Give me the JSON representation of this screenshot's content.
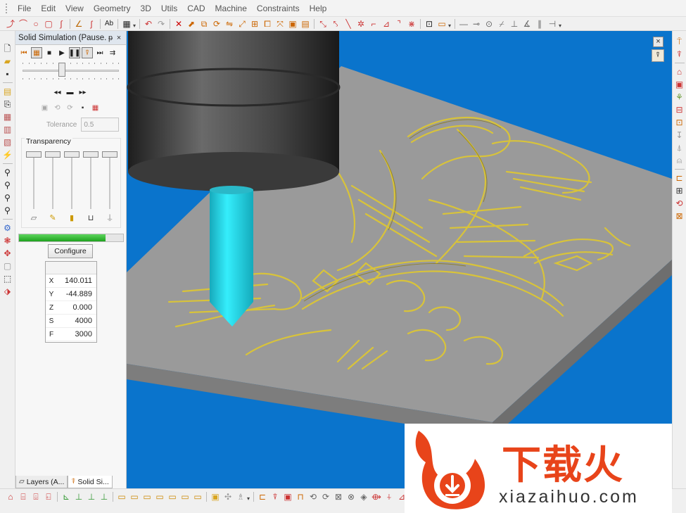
{
  "menu": [
    "File",
    "Edit",
    "View",
    "Geometry",
    "3D",
    "Utils",
    "CAD",
    "Machine",
    "Constraints",
    "Help"
  ],
  "panel": {
    "title": "Solid Simulation (Pause...",
    "pin": "ᵽ",
    "close": "×",
    "tolerance_label": "Tolerance",
    "tolerance_value": "0.5",
    "transparency_label": "Transparency",
    "progress_fraction": 0.83,
    "speed_fraction": 0.4,
    "configure_label": "Configure",
    "coords": [
      {
        "axis": "X",
        "value": "140.011"
      },
      {
        "axis": "Y",
        "value": "-44.889"
      },
      {
        "axis": "Z",
        "value": "0.000"
      },
      {
        "axis": "S",
        "value": "4000"
      },
      {
        "axis": "F",
        "value": "3000"
      }
    ],
    "tabs": [
      {
        "label": "Layers (A...",
        "active": false
      },
      {
        "label": "Solid Si...",
        "active": true
      }
    ]
  },
  "viewport": {
    "close_glyph": "×",
    "colors": {
      "background": "#0a74cc",
      "stock": "#9a9a9a",
      "engraving": "#d8c33a",
      "tool": "#22d8e8",
      "spindle": "#4a4a4a"
    }
  },
  "watermark": {
    "title": "下载火",
    "url": "xiazaihuo.com"
  }
}
